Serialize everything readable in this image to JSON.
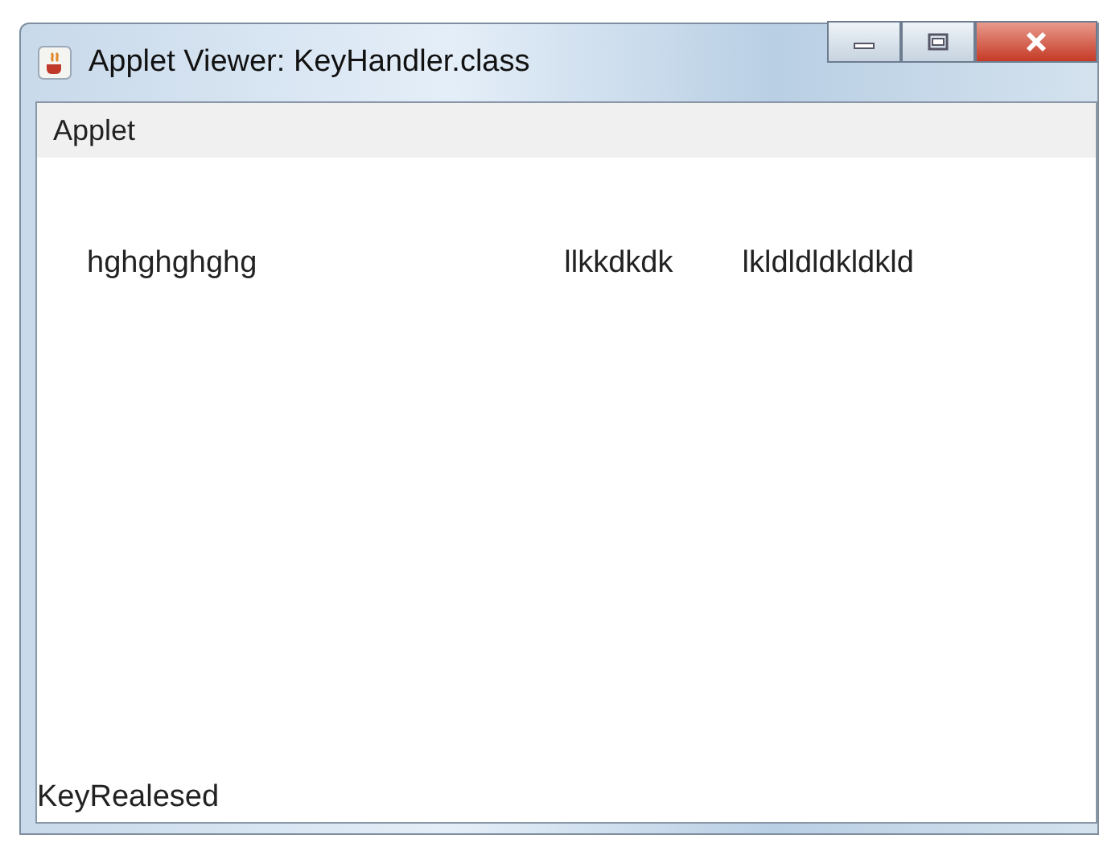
{
  "window": {
    "title": "Applet Viewer: KeyHandler.class"
  },
  "menu_bar": {
    "items": [
      "Applet"
    ]
  },
  "applet": {
    "texts": [
      "hghghghghg",
      "llkkdkdk",
      "lkldldldkldkld"
    ]
  },
  "status_bar": "KeyRealesed"
}
